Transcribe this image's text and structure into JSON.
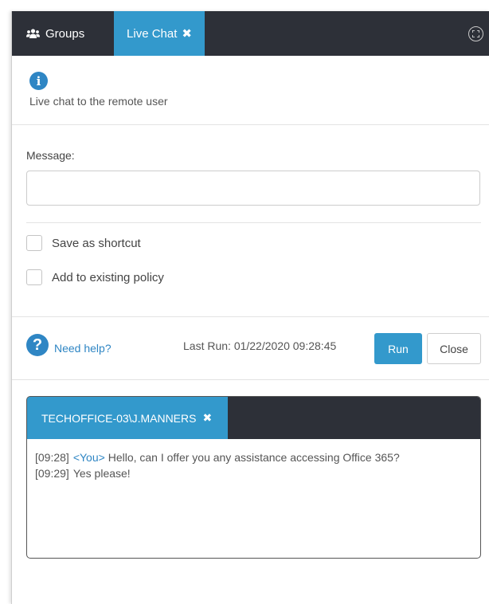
{
  "tabs": {
    "groups_label": "Groups",
    "live_chat_label": "Live Chat",
    "close_symbol": "✖"
  },
  "info": {
    "icon_letter": "i",
    "description": "Live chat to the remote user"
  },
  "form": {
    "message_label": "Message:",
    "message_value": "",
    "save_shortcut_label": "Save as shortcut",
    "save_shortcut_checked": false,
    "add_policy_label": "Add to existing policy",
    "add_policy_checked": false
  },
  "actions": {
    "help_symbol": "?",
    "help_label": "Need help?",
    "last_run": "Last Run: 01/22/2020 09:28:45",
    "run_label": "Run",
    "close_label": "Close"
  },
  "chat": {
    "session_tab": "TECHOFFICE-03\\J.MANNERS",
    "messages": [
      {
        "time": "[09:28]",
        "sender": "<You>",
        "text": "Hello, can I offer you any assistance accessing Office 365?"
      },
      {
        "time": "[09:29]",
        "sender": "",
        "text": "Yes please!"
      }
    ]
  },
  "colors": {
    "accent": "#3399cc",
    "dark_bar": "#2d3038",
    "info_blue": "#2f86c4"
  }
}
